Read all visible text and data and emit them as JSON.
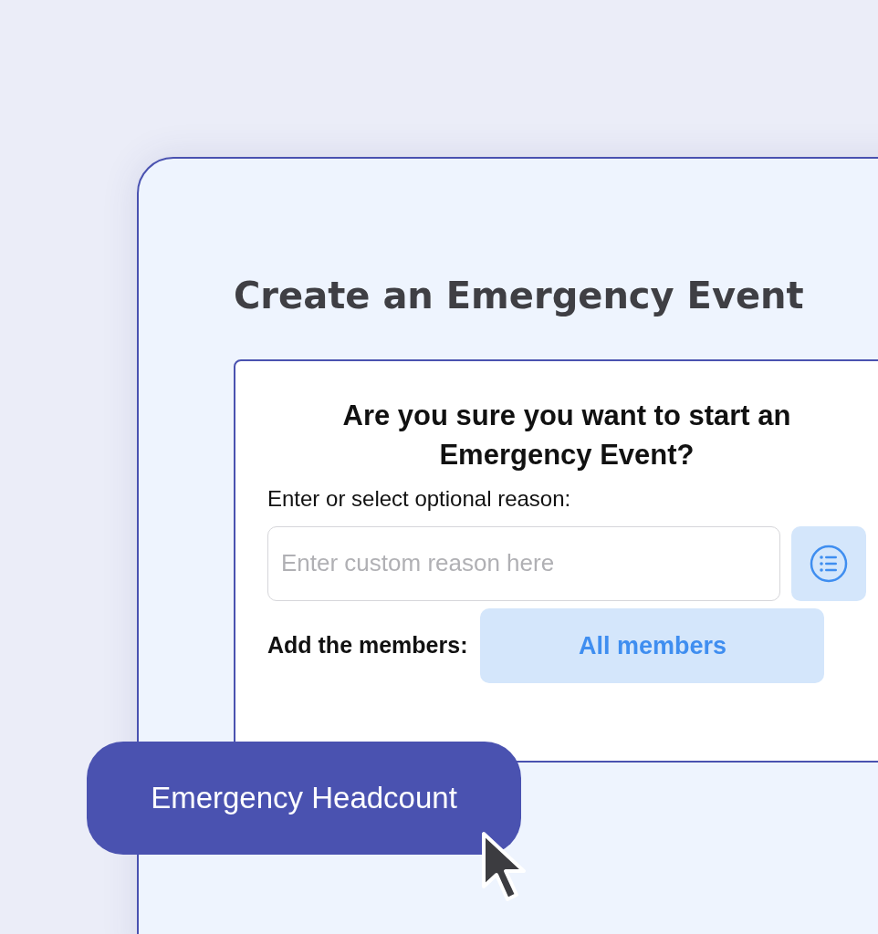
{
  "panel": {
    "title": "Create an Emergency Event"
  },
  "dialog": {
    "heading": "Are you sure you want to start an Emergency Event?",
    "reason_label": "Enter or select optional reason:",
    "reason_field": {
      "placeholder": "Enter custom reason here"
    },
    "members_label": "Add the members:",
    "members_button": "All members"
  },
  "badge": {
    "label": "Emergency Headcount"
  }
}
